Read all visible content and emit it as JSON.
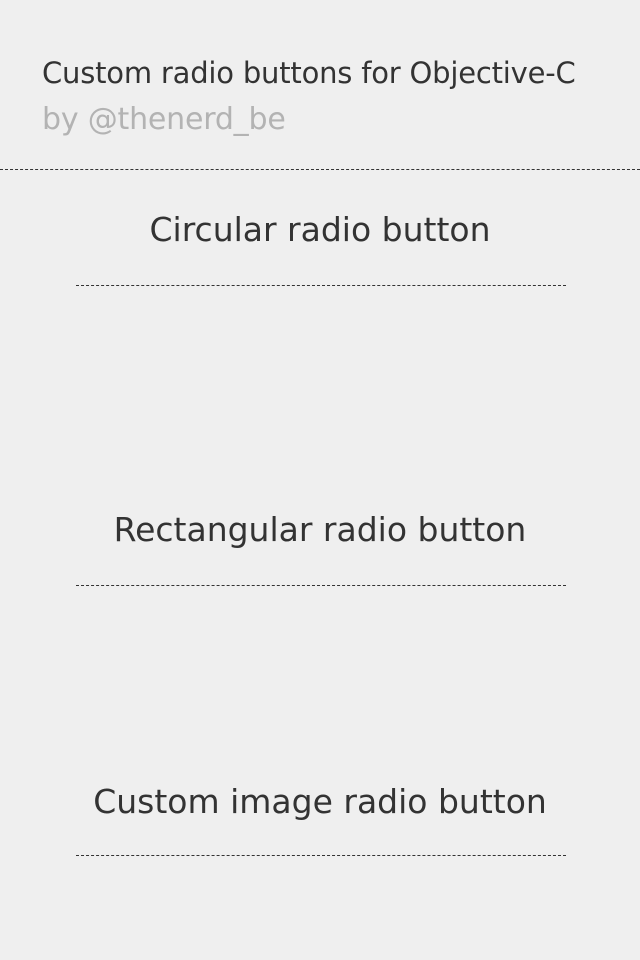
{
  "header": {
    "title": "Custom radio buttons for Objective-C",
    "subtitle": "by @thenerd_be"
  },
  "sections": [
    {
      "title": "Circular radio button"
    },
    {
      "title": "Rectangular radio button"
    },
    {
      "title": "Custom image radio button"
    }
  ],
  "colors": {
    "background": "#efefef",
    "text": "#333333",
    "subtitle": "#b3b3b3"
  }
}
